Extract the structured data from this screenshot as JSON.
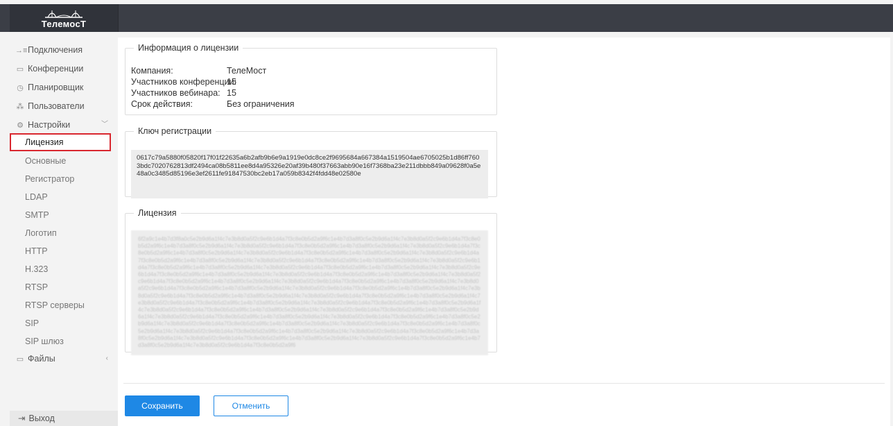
{
  "app": {
    "logo_text": "ТелемосТ"
  },
  "sidebar": {
    "items": [
      {
        "label": "Подключения"
      },
      {
        "label": "Конференции"
      },
      {
        "label": "Планировщик"
      },
      {
        "label": "Пользователи"
      },
      {
        "label": "Настройки"
      }
    ],
    "settings_items": [
      {
        "label": "Лицензия"
      },
      {
        "label": "Основные"
      },
      {
        "label": "Регистратор"
      },
      {
        "label": "LDAP"
      },
      {
        "label": "SMTP"
      },
      {
        "label": "Логотип"
      },
      {
        "label": "HTTP"
      },
      {
        "label": "H.323"
      },
      {
        "label": "RTSP"
      },
      {
        "label": "RTSP серверы"
      },
      {
        "label": "SIP"
      },
      {
        "label": "SIP шлюз"
      }
    ],
    "files": {
      "label": "Файлы"
    },
    "logout": {
      "label": "Выход"
    }
  },
  "license_info": {
    "title": "Информация о лицензии",
    "rows": [
      {
        "label": "Компания:",
        "value": "ТелеМост"
      },
      {
        "label": "Участников конференции:",
        "value": "15"
      },
      {
        "label": "Участников вебинара:",
        "value": "15"
      },
      {
        "label": "Срок действия:",
        "value": "Без ограничения"
      }
    ]
  },
  "registration_key": {
    "title": "Ключ регистрации",
    "value": "0617c79a5880f05820f17f01f22635a6b2afb9b6e9a1919e0dc8ce2f9695684a667384a1519504ae6705025b1d86ff7603bdc7020762813df2494ca08b5811ee8d4a95326e20af39b480f37663abb90e16f7368ba23e211dbbb849a09628f0a5e48a0c3485d85196e3ef2611fe91847530bc2eb17a059b8342f4fdd48e02580e"
  },
  "license": {
    "title": "Лицензия",
    "blurred_value": "6f2a9c1e4b7d3f8a0c5e2b9d6a1f4c7e3b8d0a5f2c9e6b1d4a7f3c8e0b5d2a9f6c1e4b7d3a8f0c5e2b9d6a1f4c7e3b8d0a5f2c9e6b1d4a7f3c8e0b5d2a9f6c1e4b7d3a8f0c5e2b9d6a1f4c7e3b8d0a5f2c9e6b1d4a7f3c8e0b5d2a9f6c1e4b7d3a8f0c5e2b9d6a1f4c7e3b8d0a5f2c9e6b1d4a7f3c8e0b5d2a9f6c1e4b7d3a8f0c5e2b9d6a1f4c7e3b8d0a5f2c9e6b1d4a7f3c8e0b5d2a9f6c1e4b7d3a8f0c5e2b9d6a1f4c7e3b8d0a5f2c9e6b1d4a7f3c8e0b5d2a9f6c1e4b7d3a8f0c5e2b9d6a1f4c7e3b8d0a5f2c9e6b1d4a7f3c8e0b5d2a9f6c1e4b7d3a8f0c5e2b9d6a1f4c7e3b8d0a5f2c9e6b1d4a7f3c8e0b5d2a9f6c1e4b7d3a8f0c5e2b9d6a1f4c7e3b8d0a5f2c9e6b1d4a7f3c8e0b5d2a9f6c1e4b7d3a8f0c5e2b9d6a1f4c7e3b8d0a5f2c9e6b1d4a7f3c8e0b5d2a9f6c1e4b7d3a8f0c5e2b9d6a1f4c7e3b8d0a5f2c9e6b1d4a7f3c8e0b5d2a9f6c1e4b7d3a8f0c5e2b9d6a1f4c7e3b8d0a5f2c9e6b1d4a7f3c8e0b5d2a9f6c1e4b7d3a8f0c5e2b9d6a1f4c7e3b8d0a5f2c9e6b1d4a7f3c8e0b5d2a9f6c1e4b7d3a8f0c5e2b9d6a1f4c7e3b8d0a5f2c9e6b1d4a7f3c8e0b5d2a9f6c1e4b7d3a8f0c5e2b9d6a1f4c7e3b8d0a5f2c9e6b1d4a7f3c8e0b5d2a9f6c1e4b7d3a8f0c5e2b9d6a1f4c7e3b8d0a5f2c9e6b1d4a7f3c8e0b5d2a9f6c1e4b7d3a8f0c5e2b9d6a1f4c7e3b8d0a5f2c9e6b1d4a7f3c8e0b5d2a9f6c1e4b7d3a8f0c5e2b9d6a1f4c7e3b8d0a5f2c9e6b1d4a7f3c8e0b5d2a9f6c1e4b7d3a8f0c5e2b9d6a1f4c7e3b8d0a5f2c9e6b1d4a7f3c8e0b5d2a9f6c1e4b7d3a8f0c5e2b9d6a1f4c7e3b8d0a5f2c9e6b1d4a7f3c8e0b5d2a9f6c1e4b7d3a8f0c5e2b9d6a1f4c7e3b8d0a5f2c9e6b1d4a7f3c8e0b5d2a9f6c1e4b7d3a8f0c5e2b9d6a1f4c7e3b8d0a5f2c9e6b1d4a7f3c8e0b5d2a9f6c1e4b7d3a8f0c5e2b9d6a1f4c7e3b8d0a5f2c9e6b1d4a7f3c8e0b5d2a9f6c1e4b7d3a8f0c5e2b9d6a1f4c7e3b8d0a5f2c9e6b1d4a7f3c8e0b5d2a9f6c1e4b7d3a8f0c5e2b9d6a1f4c7e3b8d0a5f2c9e6b1d4a7f3c8e0b5d2a9f6c1e4b7d3a8f0c5e2b9d6a1f4c7e3b8d0a5f2c9e6b1d4a7f3c8e0b5d2a9f6c1e4b7d3a8f0c5e2b9d6a1f4c7e3b8d0a5f2c9e6b1d4a7f3c8e0b5d2a9f6c1e4b7d3a8f0c5e2b9d6a1f4c7e3b8d0a5f2c9e6b1d4a7f3c8e0b5d2a9f6c1e4b7d3a8f0c5e2b9d6a1f4c7e3b8d0a5f2c9e6b1d4a7f3c8e0b5d2a9f6c1e4b7d3a8f0c5e2b9d6a1f4c7e3b8d0a5f2c9e6b1d4a7f3c8e0b5d2a9f6"
  },
  "actions": {
    "save_label": "Сохранить",
    "cancel_label": "Отменить"
  },
  "colors": {
    "accent": "#1e88e5",
    "topbar": "#3b3e46",
    "active_outline": "#d9272f"
  }
}
